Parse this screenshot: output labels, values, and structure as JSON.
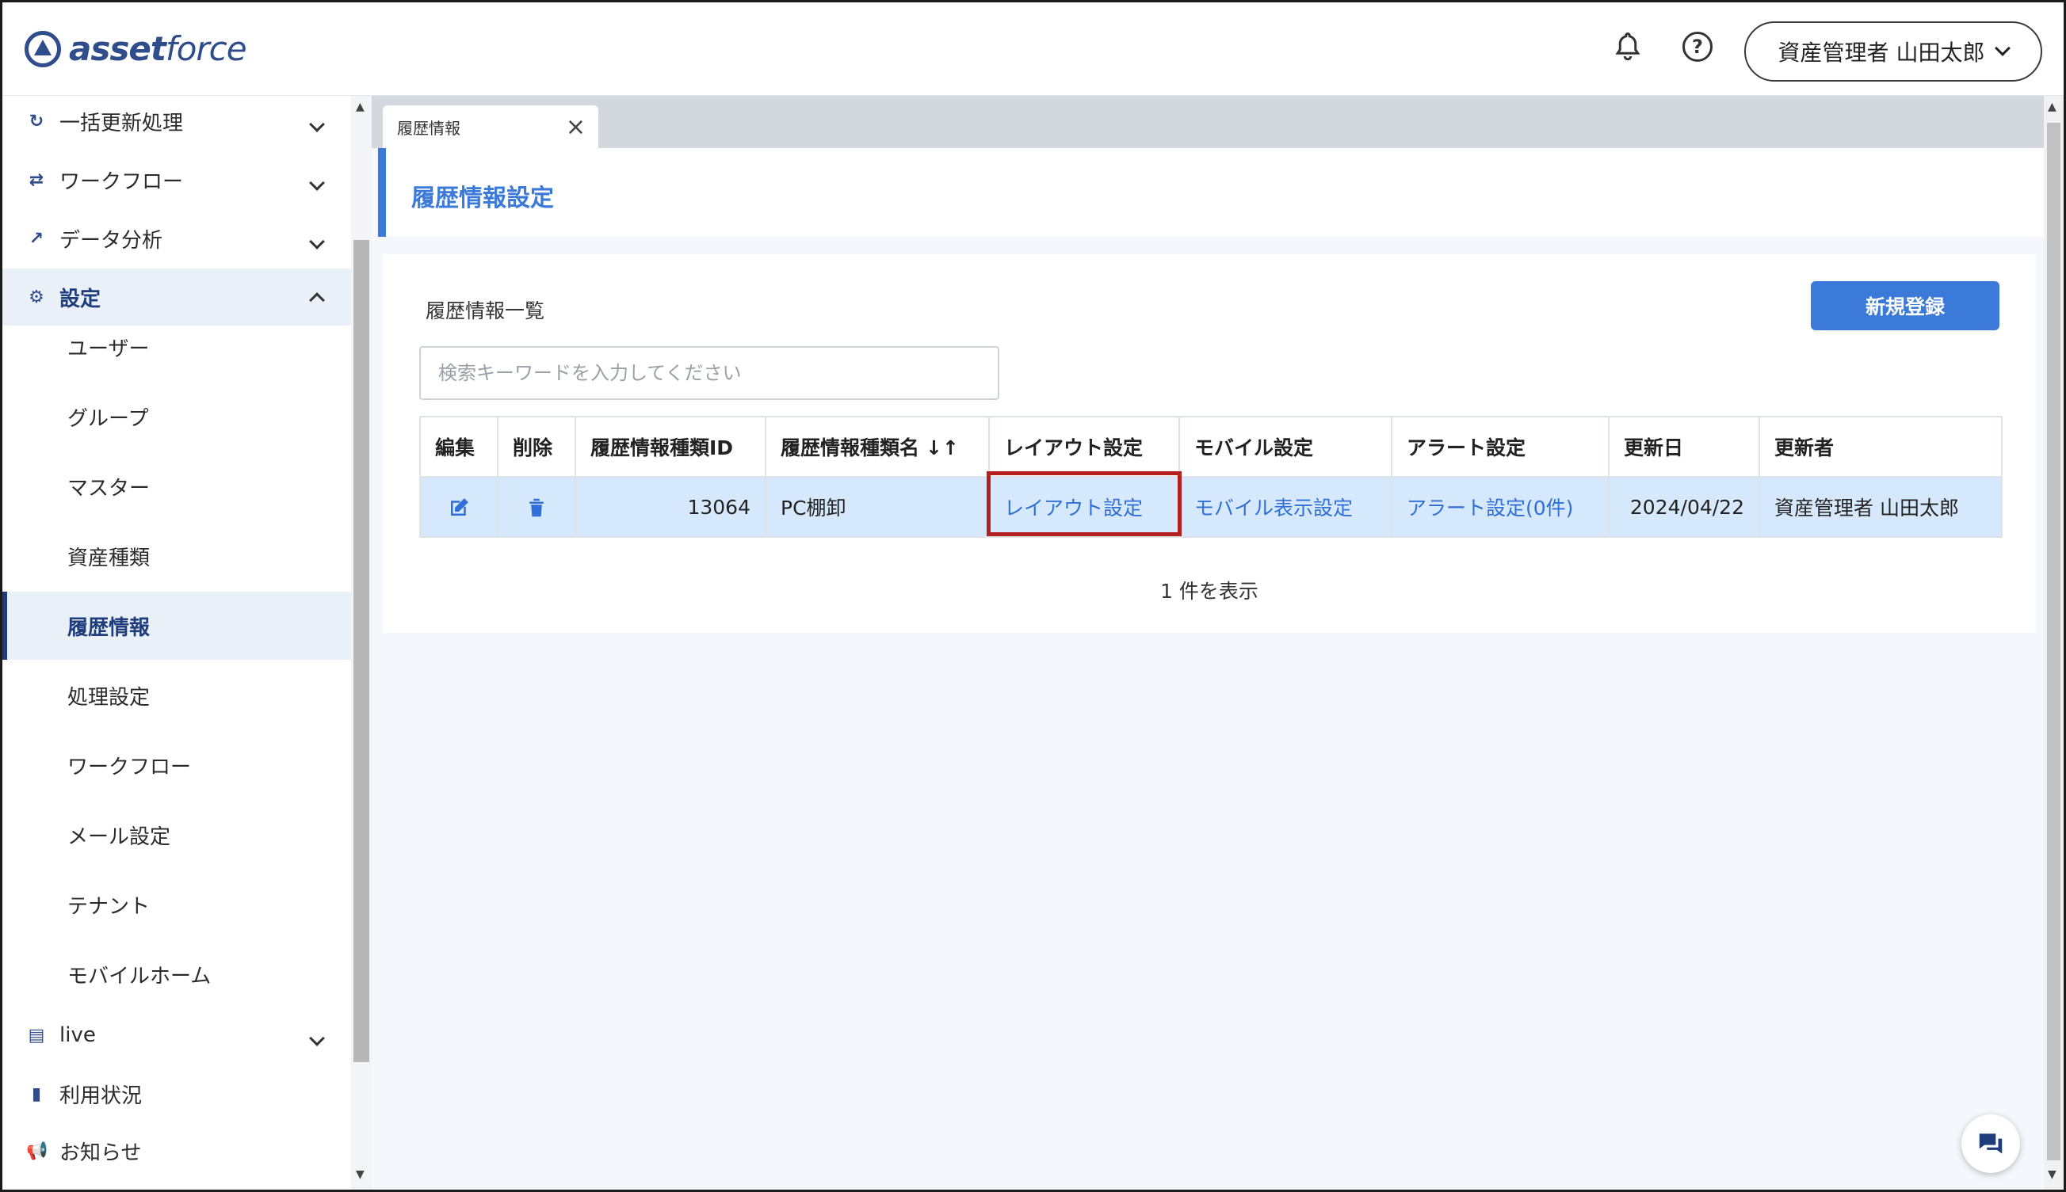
{
  "header": {
    "logo_bold": "asset",
    "logo_light": "force",
    "user_name": "資産管理者 山田太郎"
  },
  "sidebar": {
    "top_items": [
      {
        "label": "一括更新処理",
        "icon": "refresh-icon"
      },
      {
        "label": "ワークフロー",
        "icon": "workflow-icon"
      },
      {
        "label": "データ分析",
        "icon": "analytics-icon"
      },
      {
        "label": "設定",
        "icon": "gear-icon"
      }
    ],
    "sub_items": [
      "ユーザー",
      "グループ",
      "マスター",
      "資産種類",
      "履歴情報",
      "処理設定",
      "ワークフロー",
      "メール設定",
      "テナント",
      "モバイルホーム"
    ],
    "selected_sub": "履歴情報",
    "bottom_items": [
      {
        "label": "live",
        "icon": "chat-icon"
      },
      {
        "label": "利用状況",
        "icon": "bar-chart-icon"
      },
      {
        "label": "お知らせ",
        "icon": "megaphone-icon"
      }
    ]
  },
  "tab": {
    "label": "履歴情報"
  },
  "page": {
    "title": "履歴情報設定"
  },
  "panel": {
    "title": "履歴情報一覧",
    "new_button": "新規登録",
    "search_placeholder": "検索キーワードを入力してください",
    "count_text": "1 件を表示"
  },
  "table": {
    "headers": [
      "編集",
      "削除",
      "履歴情報種類ID",
      "履歴情報種類名",
      "レイアウト設定",
      "モバイル設定",
      "アラート設定",
      "更新日",
      "更新者"
    ],
    "rows": [
      {
        "id": "13064",
        "name": "PC棚卸",
        "layout": "レイアウト設定",
        "mobile": "モバイル表示設定",
        "alert": "アラート設定(0件)",
        "updated": "2024/04/22",
        "updater": "資産管理者 山田太郎"
      }
    ]
  },
  "colors": {
    "accent": "#3c7ad9",
    "brand": "#2f4d8a",
    "row_selected": "#d6e8fb",
    "highlight_border": "#b41f1f"
  }
}
